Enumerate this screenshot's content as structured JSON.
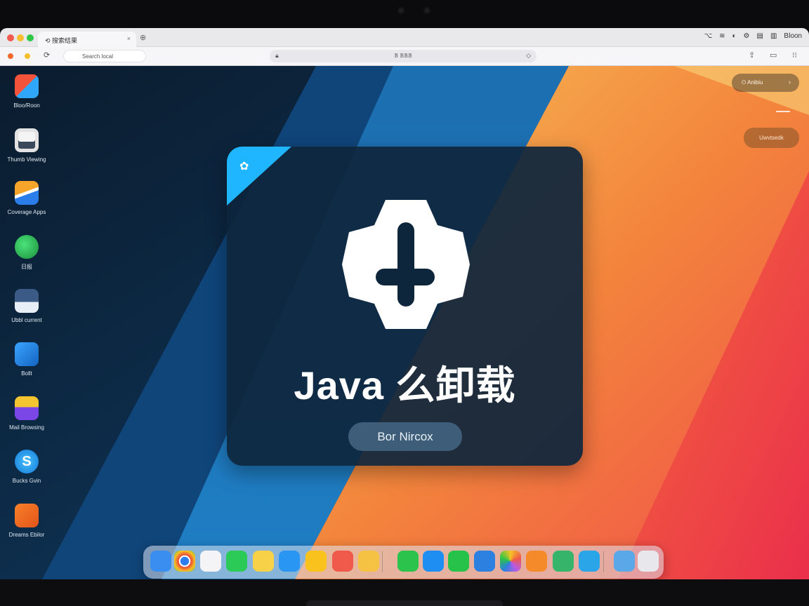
{
  "browser": {
    "tab_title": "搜索结果",
    "tab_close": "×",
    "new_tab": "⊕",
    "address_pill": "Search local",
    "url": "𝔹 𝔹𝔹𝔹",
    "system_icons": [
      "⌥",
      "≋",
      "◐",
      "⚙",
      "▤",
      "▥",
      "Bloon"
    ]
  },
  "desktop": {
    "icons": [
      {
        "label": "Bloo/Roon",
        "colors": [
          "#f2533a",
          "#2fa6f7"
        ]
      },
      {
        "label": "Thumb Viewing",
        "colors": [
          "#f4f4f4",
          "#3a4a5c"
        ]
      },
      {
        "label": "Coverage Apps",
        "colors": [
          "#f7a52a",
          "#2b7de9"
        ]
      },
      {
        "label": "日报",
        "colors": [
          "#2bcf5b",
          "#1a8f3a"
        ]
      },
      {
        "label": "Ubbl current",
        "colors": [
          "#3c5a86",
          "#e8eef6"
        ]
      },
      {
        "label": "Bollt",
        "colors": [
          "#1f8ff0",
          "#1464c2"
        ]
      },
      {
        "label": "Mail Browsing",
        "colors": [
          "#f5c531",
          "#7a46e6"
        ]
      },
      {
        "label": "Bucks Gvin",
        "colors": [
          "#25a9f0",
          "#1579d6"
        ]
      },
      {
        "label": "Dreams Ebilor",
        "colors": [
          "#f7812a",
          "#e4541a"
        ]
      }
    ],
    "top_right_pill": "Anibiu",
    "top_right_chevron": "›",
    "orange_pill": "Uwvtsedk"
  },
  "card": {
    "title": "Java 么卸载",
    "button_label": "Bor Nircox",
    "corner_icon": "✿",
    "accent": "#1fb6ff"
  },
  "dock": {
    "items": [
      {
        "name": "finder",
        "color": "#3a8ef0"
      },
      {
        "name": "chrome",
        "color": "#e9eef5"
      },
      {
        "name": "calendar",
        "color": "#f4f4f6"
      },
      {
        "name": "check",
        "color": "#2bc955"
      },
      {
        "name": "notes",
        "color": "#f7d148"
      },
      {
        "name": "translate",
        "color": "#2996f3"
      },
      {
        "name": "pac",
        "color": "#f9c21d"
      },
      {
        "name": "reminders",
        "color": "#f05a4a"
      },
      {
        "name": "stickies",
        "color": "#f6c244"
      },
      {
        "name": "wechat",
        "color": "#2cc34d"
      },
      {
        "name": "add",
        "color": "#1e8ef2"
      },
      {
        "name": "phone",
        "color": "#26c24a"
      },
      {
        "name": "mail",
        "color": "#2b80e0"
      },
      {
        "name": "photos",
        "color": "#b95ae6"
      },
      {
        "name": "pages",
        "color": "#f48a2a"
      },
      {
        "name": "maps",
        "color": "#35b46a"
      },
      {
        "name": "files",
        "color": "#2aa5e8"
      },
      {
        "name": "tools",
        "color": "#5aa8e8"
      },
      {
        "name": "trash",
        "color": "#e8e8ec"
      }
    ]
  }
}
